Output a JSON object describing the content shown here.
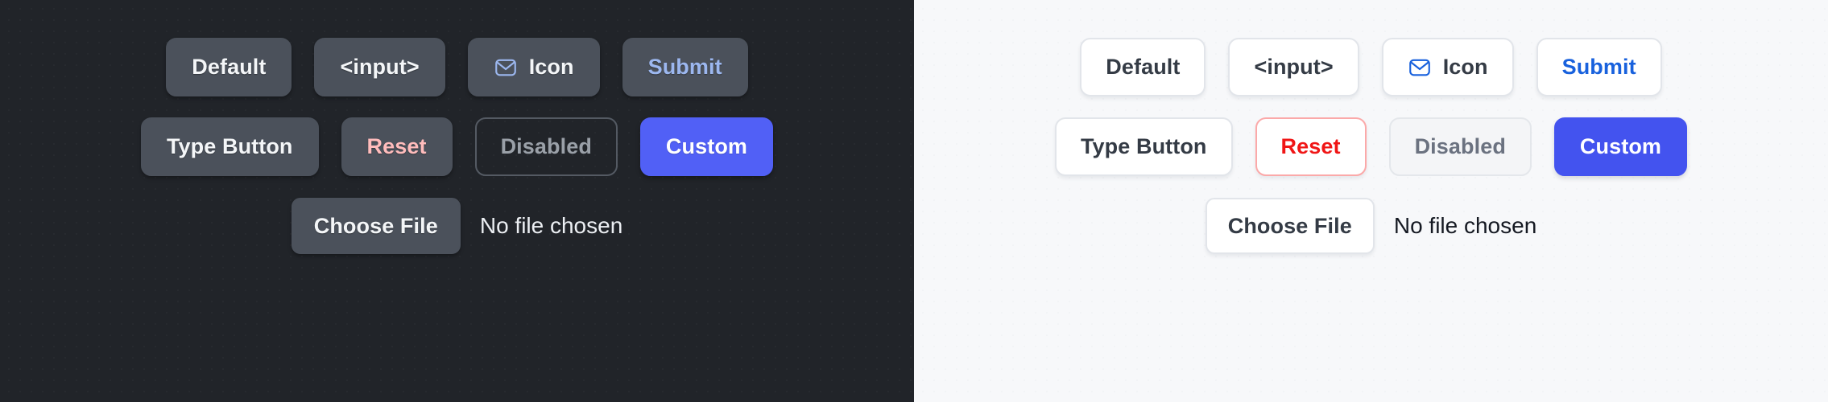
{
  "panels": [
    {
      "theme": "dark",
      "background": "#212429",
      "rows": [
        [
          {
            "name": "default-button",
            "label": "Default",
            "variant": "neutral",
            "icon": null
          },
          {
            "name": "input-button",
            "label": "<input>",
            "variant": "neutral",
            "icon": null
          },
          {
            "name": "icon-button",
            "label": "Icon",
            "variant": "neutral",
            "icon": "envelope-icon"
          },
          {
            "name": "submit-button",
            "label": "Submit",
            "variant": "accent-text",
            "icon": null
          }
        ],
        [
          {
            "name": "type-button",
            "label": "Type Button",
            "variant": "neutral",
            "icon": null
          },
          {
            "name": "reset-button",
            "label": "Reset",
            "variant": "danger-text",
            "icon": null
          },
          {
            "name": "disabled-button",
            "label": "Disabled",
            "variant": "disabled",
            "icon": null
          },
          {
            "name": "custom-button",
            "label": "Custom",
            "variant": "primary",
            "icon": null
          }
        ]
      ],
      "file_input": {
        "button_label": "Choose File",
        "status_text": "No file chosen"
      }
    },
    {
      "theme": "light",
      "background": "#f7f8fa",
      "rows": [
        [
          {
            "name": "default-button",
            "label": "Default",
            "variant": "neutral",
            "icon": null
          },
          {
            "name": "input-button",
            "label": "<input>",
            "variant": "neutral",
            "icon": null
          },
          {
            "name": "icon-button",
            "label": "Icon",
            "variant": "neutral",
            "icon": "envelope-icon"
          },
          {
            "name": "submit-button",
            "label": "Submit",
            "variant": "accent-text",
            "icon": null
          }
        ],
        [
          {
            "name": "type-button",
            "label": "Type Button",
            "variant": "neutral",
            "icon": null
          },
          {
            "name": "reset-button",
            "label": "Reset",
            "variant": "danger-text",
            "icon": null
          },
          {
            "name": "disabled-button",
            "label": "Disabled",
            "variant": "disabled",
            "icon": null
          },
          {
            "name": "custom-button",
            "label": "Custom",
            "variant": "primary",
            "icon": null
          }
        ]
      ],
      "file_input": {
        "button_label": "Choose File",
        "status_text": "No file chosen"
      }
    }
  ],
  "colors": {
    "dark_background": "#212429",
    "light_background": "#f7f8fa",
    "dark_button_fill": "#4b515b",
    "dark_accent_text": "#9cb7ef",
    "dark_danger_text": "#ffbcbc",
    "dark_primary_fill": "#5160f6",
    "light_button_fill": "#ffffff",
    "light_border": "#e2e5ea",
    "light_accent_text": "#1861dd",
    "light_danger_text": "#f01616",
    "light_danger_border": "#fba9a9",
    "light_primary_fill": "#4353ef",
    "light_disabled_text": "#6b7280"
  }
}
